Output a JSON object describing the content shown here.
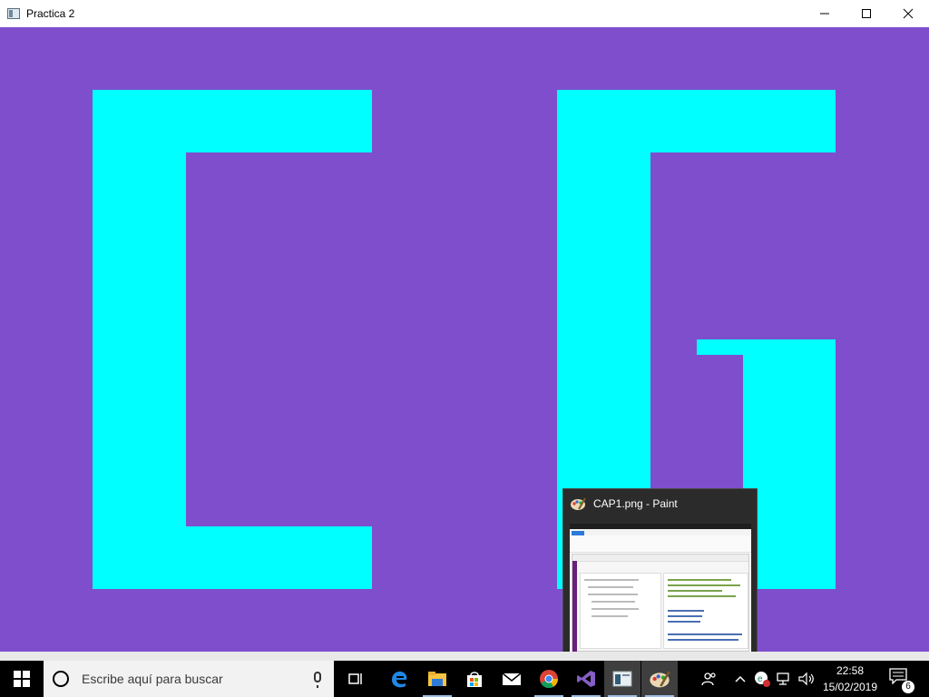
{
  "window": {
    "title": "Practica 2",
    "controls": {
      "minimize": "—",
      "maximize": "☐",
      "close": "✕"
    },
    "background_color": "#7f4ecd",
    "shape_color": "#00ffff"
  },
  "thumbnail": {
    "title": "CAP1.png - Paint"
  },
  "taskbar": {
    "search_placeholder": "Escribe aquí para buscar",
    "apps": [
      "task-view",
      "edge",
      "file-explorer",
      "store",
      "mail",
      "chrome",
      "visual-studio",
      "practica-window",
      "paint"
    ],
    "clock_time": "22:58",
    "clock_date": "15/02/2019",
    "notification_count": "6"
  }
}
